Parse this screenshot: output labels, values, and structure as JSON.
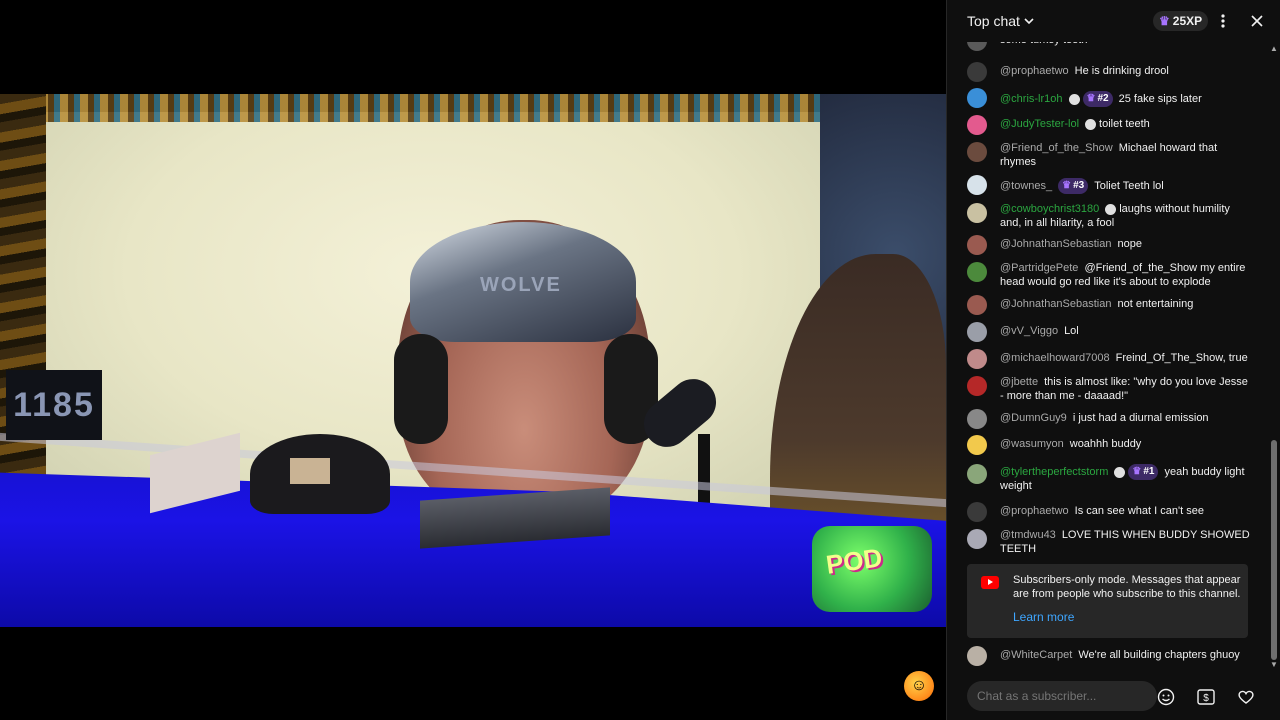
{
  "video": {
    "scoreboard": "1185",
    "logo_text": "POD",
    "cap_text": "WOLVE"
  },
  "chat": {
    "title": "Top chat",
    "xp_label": "25XP",
    "messages": [
      {
        "author": "",
        "text": "some turkey teeth",
        "avatar": "#5a5a5a"
      },
      {
        "author": "@prophaetwo",
        "text": "He is drinking drool",
        "avatar": "#3a3a3a"
      },
      {
        "author": "@chris-lr1oh",
        "badge": "#2",
        "text": "25 fake sips later",
        "member": true,
        "skull": true,
        "avatar": "#3a8fd8"
      },
      {
        "author": "@JudyTester-lol",
        "text": "toilet teeth",
        "member": true,
        "skull": true,
        "avatar": "#e35a8e"
      },
      {
        "author": "@Friend_of_the_Show",
        "text": "Michael howard that rhymes",
        "avatar": "#6b4b3e"
      },
      {
        "author": "@townes_",
        "badge": "#3",
        "text": "Toliet Teeth lol",
        "avatar": "#d7e2ea"
      },
      {
        "author": "@cowboychrist3180",
        "text": "laughs without humility and, in all hilarity, a fool",
        "member": true,
        "skull": true,
        "avatar": "#c9c1a2"
      },
      {
        "author": "@JohnathanSebastian",
        "text": "nope",
        "avatar": "#9a5a50"
      },
      {
        "author": "@PartridgePete",
        "text": "@Friend_of_the_Show my entire head would go red like it's about to explode",
        "avatar": "#4c8a3c"
      },
      {
        "author": "@JohnathanSebastian",
        "text": "not entertaining",
        "avatar": "#9a5a50"
      },
      {
        "author": "@vV_Viggo",
        "text": "Lol",
        "avatar": "#9a9ea8"
      },
      {
        "author": "@michaelhoward7008",
        "text": "Freind_Of_The_Show, true",
        "avatar": "#c08a8a"
      },
      {
        "author": "@jbette",
        "text": "this is almost like: \"why do you love Jesse - more than me - daaaad!\"",
        "avatar": "#b52828"
      },
      {
        "author": "@DumnGuy9",
        "text": "i just had a diurnal emission",
        "avatar": "#888888"
      },
      {
        "author": "@wasumyon",
        "text": "woahhh buddy",
        "avatar": "#f2c94c"
      },
      {
        "author": "@tylertheperfectstorm",
        "badge": "#1",
        "text": "yeah buddy light weight",
        "member": true,
        "skull": true,
        "avatar": "#8aa67a"
      },
      {
        "author": "@prophaetwo",
        "text": "Is can see what I can't see",
        "avatar": "#3a3a3a"
      },
      {
        "author": "@tmdwu43",
        "text": "LOVE THIS WHEN BUDDY SHOWED TEETH",
        "avatar": "#a9a9b5"
      }
    ],
    "subscribers_notice": {
      "text": "Subscribers-only mode. Messages that appear are from people who subscribe to this channel.",
      "link": "Learn more"
    },
    "last_message": {
      "author": "@WhiteCarpet",
      "text": "We're all building chapters ghuoy",
      "avatar": "#b9b0a5"
    },
    "input_placeholder": "Chat as a subscriber...",
    "colors": {
      "member_name": "#2ba640",
      "link": "#3ea6ff",
      "badge": "#3d2a66",
      "crown": "#a774ff"
    }
  }
}
